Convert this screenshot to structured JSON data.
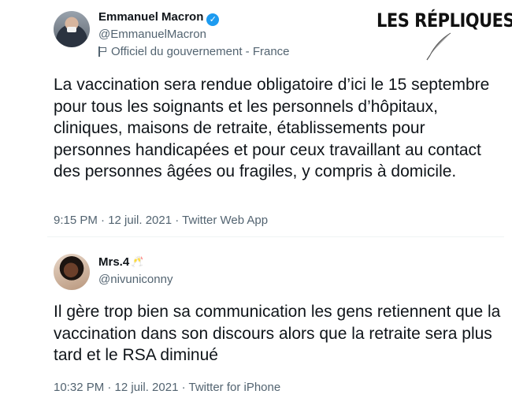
{
  "brand": {
    "text": "LES RÉPLIQUES",
    "icon": "quill-icon"
  },
  "tweets": [
    {
      "name": "Emmanuel Macron",
      "verified": true,
      "handle": "@EmmanuelMacron",
      "label": "Officiel du gouvernement - France",
      "text": "La vaccination sera rendue obligatoire d’ici le 15 septembre pour tous les soignants et les personnels d’hôpitaux, cliniques, maisons de retraite, établissements pour personnes handicapées et pour ceux travaillant au contact des personnes âgées ou fragiles, y compris à domicile.",
      "meta": "9:15 PM · 12 juil. 2021 · Twitter Web App"
    },
    {
      "name": "Mrs.4",
      "name_emoji": "🥂",
      "handle": "@nivuniconny",
      "text": "Il gère trop bien sa communication les gens retiennent que la vaccination dans son discours alors que la retraite sera plus tard et le RSA diminué",
      "meta": "10:32 PM · 12 juil. 2021 · Twitter for iPhone"
    }
  ],
  "colors": {
    "text": "#0f1419",
    "secondary": "#536471",
    "verified": "#1d9bf0"
  }
}
